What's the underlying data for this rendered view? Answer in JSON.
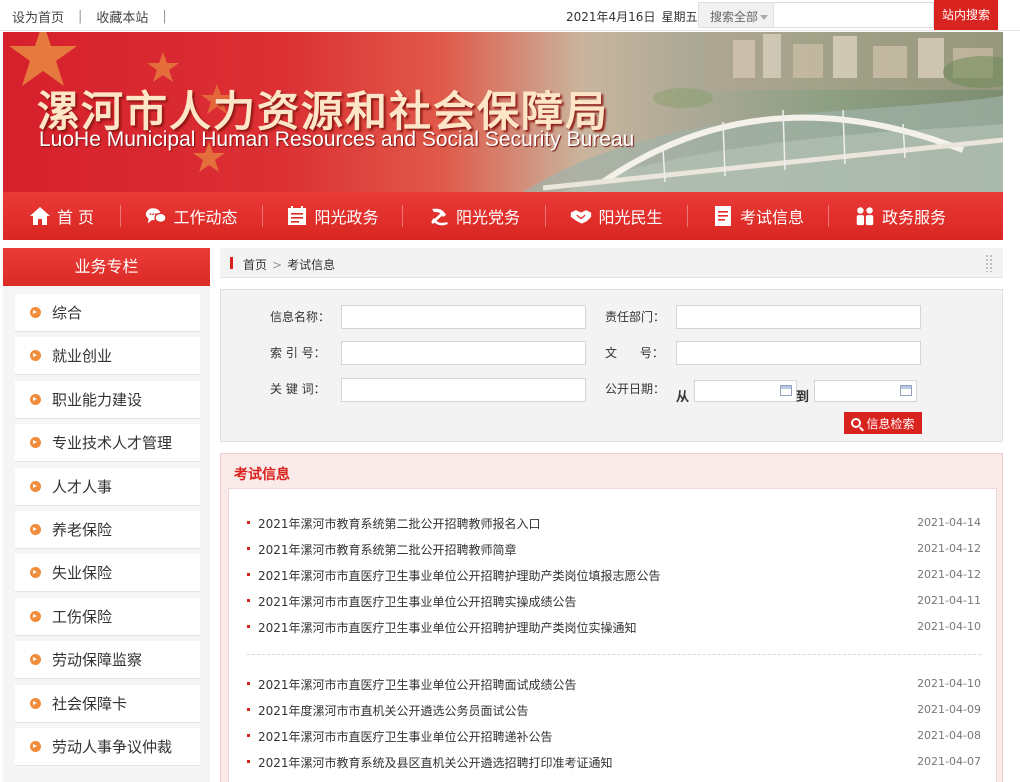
{
  "topbar": {
    "set_home": "设为首页",
    "bookmark": "收藏本站",
    "date": "2021年4月16日",
    "weekday": "星期五",
    "search_scope": "搜索全部",
    "search_button": "站内搜索"
  },
  "banner": {
    "title": "漯河市人力资源和社会保障局",
    "subtitle": "LuoHe Municipal Human Resources and Social Security Bureau"
  },
  "nav": [
    {
      "label": "首 页",
      "icon": "home-icon"
    },
    {
      "label": "工作动态",
      "icon": "chat-icon"
    },
    {
      "label": "阳光政务",
      "icon": "document-icon"
    },
    {
      "label": "阳光党务",
      "icon": "party-emblem-icon"
    },
    {
      "label": "阳光民生",
      "icon": "handshake-icon"
    },
    {
      "label": "考试信息",
      "icon": "exam-icon"
    },
    {
      "label": "政务服务",
      "icon": "people-icon"
    }
  ],
  "sidebar": {
    "heading": "业务专栏",
    "items": [
      "综合",
      "就业创业",
      "职业能力建设",
      "专业技术人才管理",
      "人才人事",
      "养老保险",
      "失业保险",
      "工伤保险",
      "劳动保障监察",
      "社会保障卡",
      "劳动人事争议仲裁"
    ]
  },
  "breadcrumb": {
    "home": "首页",
    "current": "考试信息"
  },
  "search_form": {
    "info_name_label": "信息名称：",
    "dept_label": "责任部门：",
    "index_label": "索 引 号：",
    "doc_no_label": "文      号：",
    "keyword_label": "关 键 词：",
    "date_label": "公开日期：",
    "from_label": "从",
    "to_label": "到",
    "submit": "信息检索"
  },
  "exam_panel": {
    "title": "考试信息",
    "group1": [
      {
        "title": "2021年漯河市教育系统第二批公开招聘教师报名入口",
        "date": "2021-04-14"
      },
      {
        "title": "2021年漯河市教育系统第二批公开招聘教师简章",
        "date": "2021-04-12"
      },
      {
        "title": "2021年漯河市市直医疗卫生事业单位公开招聘护理助产类岗位填报志愿公告",
        "date": "2021-04-12"
      },
      {
        "title": "2021年漯河市市直医疗卫生事业单位公开招聘实操成绩公告",
        "date": "2021-04-11"
      },
      {
        "title": "2021年漯河市市直医疗卫生事业单位公开招聘护理助产类岗位实操通知",
        "date": "2021-04-10"
      }
    ],
    "group2": [
      {
        "title": "2021年漯河市市直医疗卫生事业单位公开招聘面试成绩公告",
        "date": "2021-04-10"
      },
      {
        "title": "2021年度漯河市市直机关公开遴选公务员面试公告",
        "date": "2021-04-09"
      },
      {
        "title": "2021年漯河市市直医疗卫生事业单位公开招聘递补公告",
        "date": "2021-04-08"
      },
      {
        "title": "2021年漯河市教育系统及县区直机关公开遴选招聘打印准考证通知",
        "date": "2021-04-07"
      }
    ]
  }
}
